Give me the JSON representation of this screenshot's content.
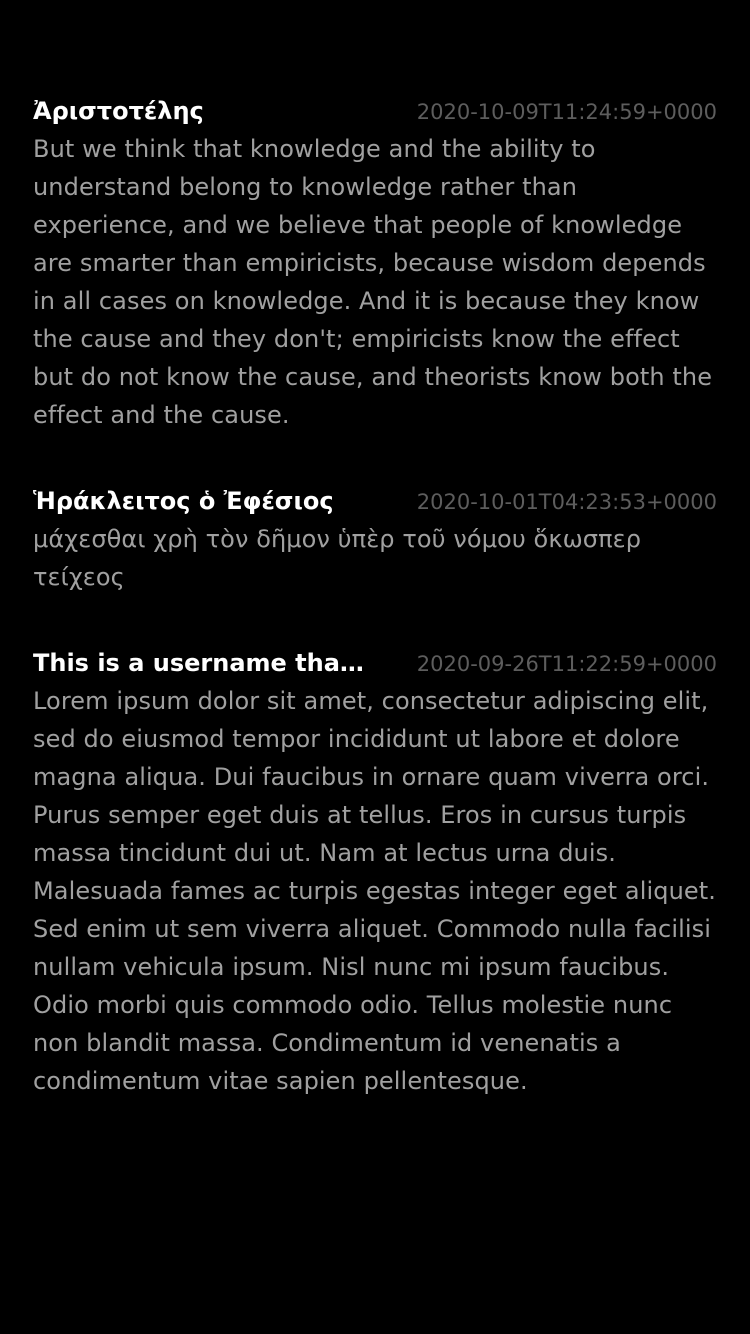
{
  "colors": {
    "background": "#000000",
    "username": "#ffffff",
    "timestamp": "#5d5d5d",
    "body": "#a0a0a0"
  },
  "posts": [
    {
      "username": "Ἀριστοτέλης",
      "timestamp": "2020-10-09T11:24:59+0000",
      "body": "But we think that knowledge and the ability to understand belong to knowledge rather than experience, and we believe that people of knowledge are smarter than empiricists, because wisdom depends in all cases on knowledge. And it is because they know the cause and they don't; empiricists know the effect but do not know the cause, and theorists know both the effect and the cause."
    },
    {
      "username": "Ἡράκλειτος ὁ Ἐφέσιος",
      "timestamp": "2020-10-01T04:23:53+0000",
      "body": "μάχεσθαι χρὴ τὸν δῆμον ὑπὲρ τοῦ νόμου ὅκωσπερ τείχεος"
    },
    {
      "username": "This is a username that...",
      "timestamp": "2020-09-26T11:22:59+0000",
      "body": "Lorem ipsum dolor sit amet, consectetur adipiscing elit, sed do eiusmod tempor incididunt ut labore et dolore magna aliqua. Dui faucibus in ornare quam viverra orci. Purus semper eget duis at tellus. Eros in cursus turpis massa tincidunt dui ut. Nam at lectus urna duis. Malesuada fames ac turpis egestas integer eget aliquet. Sed enim ut sem viverra aliquet. Commodo nulla facilisi nullam vehicula ipsum. Nisl nunc mi ipsum faucibus. Odio morbi quis commodo odio. Tellus molestie nunc non blandit massa. Condimentum id venenatis a condimentum vitae sapien pellentesque."
    }
  ]
}
